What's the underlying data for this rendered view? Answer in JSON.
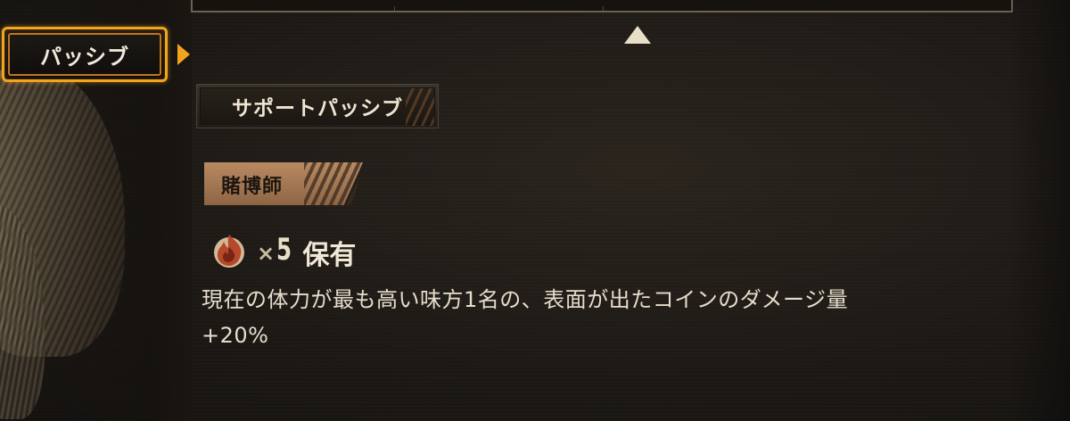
{
  "sidebar": {
    "active_tab_label": "パッシブ"
  },
  "section": {
    "header_label": "サポートパッシブ"
  },
  "passive": {
    "name": "賭博師",
    "resource_icon": "flame-icon",
    "times_mark": "×",
    "count": "5",
    "requirement_label": "保有",
    "description_line1": "現在の体力が最も高い味方1名の、表面が出たコインのダメージ量",
    "description_line2": "+20%"
  },
  "colors": {
    "accent_orange": "#f2a41c",
    "tag_tan": "#b88a63",
    "text_light": "#e5ddcb",
    "flame_red": "#b5492a"
  }
}
